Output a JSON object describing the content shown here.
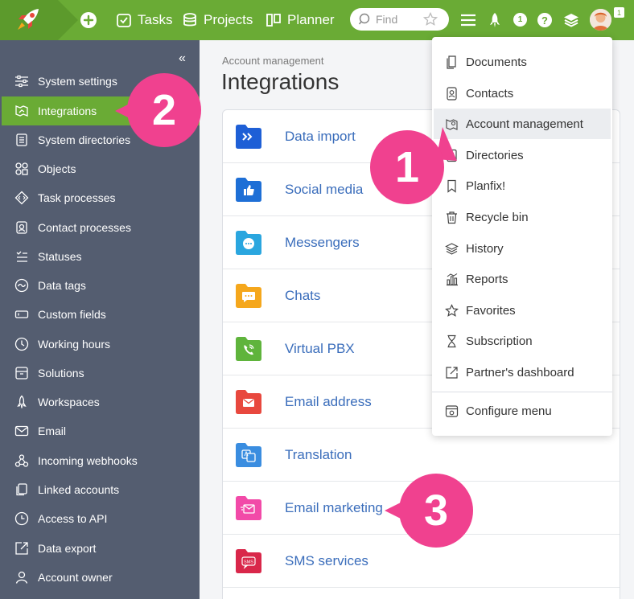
{
  "topbar": {
    "nav": [
      {
        "label": "Tasks"
      },
      {
        "label": "Projects"
      },
      {
        "label": "Planner"
      }
    ],
    "search_placeholder": "Find",
    "notification_count": "1",
    "help_label": "?",
    "avatar_badge": "1",
    "accent": "#6aab35"
  },
  "sidebar": {
    "collapse_label": "«",
    "items": [
      {
        "label": "System settings"
      },
      {
        "label": "Integrations"
      },
      {
        "label": "System directories"
      },
      {
        "label": "Objects"
      },
      {
        "label": "Task processes"
      },
      {
        "label": "Contact processes"
      },
      {
        "label": "Statuses"
      },
      {
        "label": "Data tags"
      },
      {
        "label": "Custom fields"
      },
      {
        "label": "Working hours"
      },
      {
        "label": "Solutions"
      },
      {
        "label": "Workspaces"
      },
      {
        "label": "Email"
      },
      {
        "label": "Incoming webhooks"
      },
      {
        "label": "Linked accounts"
      },
      {
        "label": "Access to API"
      },
      {
        "label": "Data export"
      },
      {
        "label": "Account owner"
      }
    ]
  },
  "main": {
    "breadcrumb": "Account management",
    "title": "Integrations",
    "integrations": [
      {
        "label": "Data import",
        "color": "#1e5fd6"
      },
      {
        "label": "Social media",
        "color": "#1e6fd6"
      },
      {
        "label": "Messengers",
        "color": "#2aa6df"
      },
      {
        "label": "Chats",
        "color": "#f5a71c"
      },
      {
        "label": "Virtual PBX",
        "color": "#5fb43c"
      },
      {
        "label": "Email address",
        "color": "#e8483e"
      },
      {
        "label": "Translation",
        "color": "#3a8de0"
      },
      {
        "label": "Email marketing",
        "color": "#f24aa8"
      },
      {
        "label": "SMS services",
        "color": "#d9274a"
      }
    ]
  },
  "dropdown": {
    "items": [
      {
        "label": "Documents"
      },
      {
        "label": "Contacts"
      },
      {
        "label": "Account management"
      },
      {
        "label": "Directories"
      },
      {
        "label": "Planfix!"
      },
      {
        "label": "Recycle bin"
      },
      {
        "label": "History"
      },
      {
        "label": "Reports"
      },
      {
        "label": "Favorites"
      },
      {
        "label": "Subscription"
      },
      {
        "label": "Partner's dashboard"
      },
      {
        "label": "Configure menu"
      }
    ]
  },
  "callouts": [
    {
      "label": "1"
    },
    {
      "label": "2"
    },
    {
      "label": "3"
    }
  ]
}
